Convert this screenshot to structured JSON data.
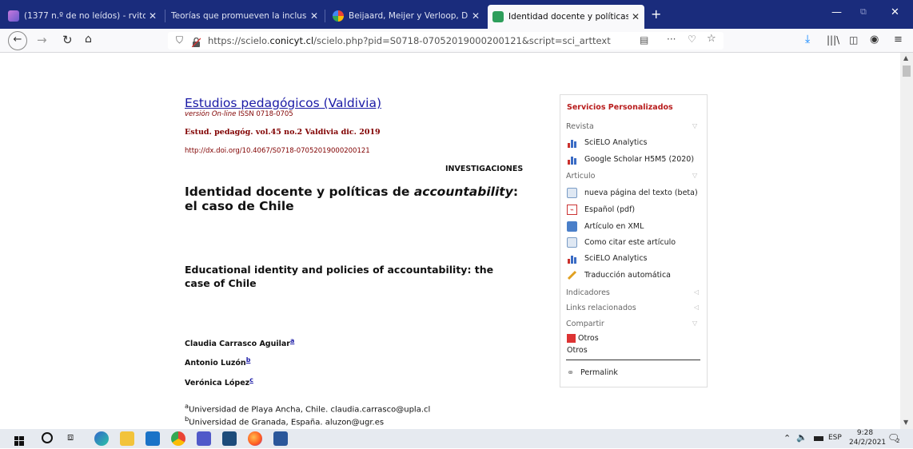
{
  "tabs": [
    {
      "title": "(1377 n.º de no leídos) - rviton",
      "close": "✕"
    },
    {
      "title": "Teorías que promueven la inclusión",
      "close": "✕"
    },
    {
      "title": "Beijaard, Meijer y Verloop, D. (2",
      "close": "✕"
    },
    {
      "title": "Identidad docente y políticas d",
      "close": "✕"
    }
  ],
  "new_tab": "+",
  "url": {
    "prefix": "https://scielo.",
    "domain": "conicyt.cl",
    "path": "/scielo.php?pid=S0718-07052019000200121&script=sci_arttext"
  },
  "journal": {
    "title": "Estudios pedagógicos (Valdivia)",
    "version_label": "versión On-line",
    "issn": "ISSN 0718-0705",
    "citation": "Estud. pedagóg. vol.45 no.2 Valdivia dic. 2019",
    "doi": "http://dx.doi.org/10.4067/S0718-07052019000200121"
  },
  "article": {
    "section": "INVESTIGACIONES",
    "title_es_1": "Identidad docente y políticas de ",
    "title_es_em": "accountability",
    "title_es_2": ":",
    "title_es_line2": "el caso de Chile",
    "title_en_line1": "Educational identity and policies of accountability: the",
    "title_en_line2": "case of Chile",
    "authors": [
      {
        "name": "Claudia Carrasco Aguilar",
        "sup": "a"
      },
      {
        "name": "Antonio Luzón",
        "sup": "b"
      },
      {
        "name": "Verónica López",
        "sup": "c"
      }
    ],
    "affiliations": [
      {
        "sup": "a",
        "text": "Universidad de Playa Ancha, Chile. claudia.carrasco@upla.cl"
      },
      {
        "sup": "b",
        "text": "Universidad de Granada, España. aluzon@ugr.es"
      }
    ]
  },
  "sidebar": {
    "heading": "Servicios Personalizados",
    "revista": "Revista",
    "revista_items": [
      "SciELO Analytics",
      "Google Scholar H5M5 (2020)"
    ],
    "articulo": "Articulo",
    "articulo_items": [
      "nueva página del texto (beta)",
      "Español (pdf)",
      "Artículo en XML",
      "Como citar este artículo",
      "SciELO Analytics",
      "Traducción automática"
    ],
    "indicadores": "Indicadores",
    "links": "Links relacionados",
    "compartir": "Compartir",
    "otros1": "Otros",
    "otros2": "Otros",
    "permalink": "Permalink"
  },
  "taskbar": {
    "lang": "ESP",
    "time": "9:28",
    "date": "24/2/2021",
    "notif_count": "2"
  },
  "colors": {
    "tabbar": "#1a2c7c",
    "link": "#1a1aa6",
    "maroon": "#800000",
    "sidebar_heading": "#b81c1c"
  }
}
